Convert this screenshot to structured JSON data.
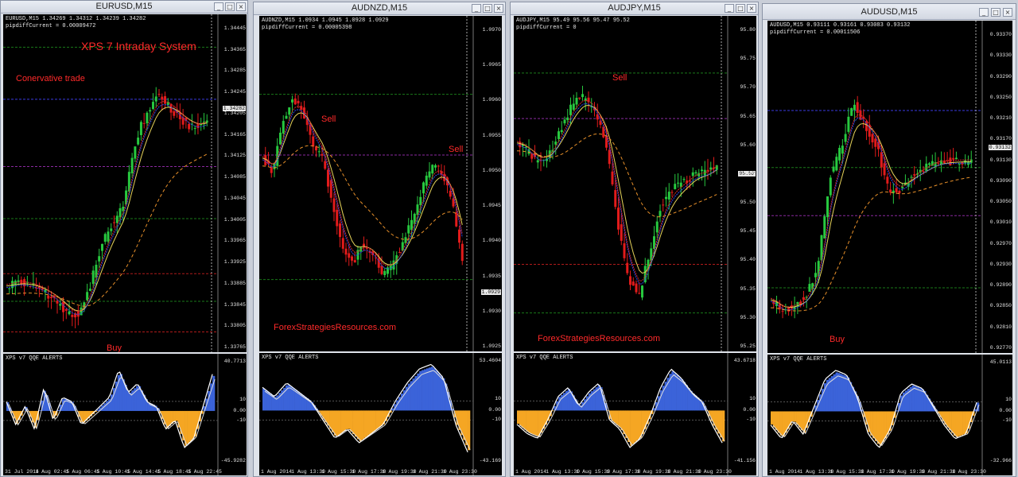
{
  "colors": {
    "bull": "#27c93f",
    "bear": "#e21b1b",
    "qqe_pos": "#3b63d9",
    "qqe_neg": "#f5a623",
    "ma_yellow": "#e6d35a",
    "ma_blue": "#2d46e6",
    "ma_red": "#d42a2a",
    "ma_orange": "#e8902a",
    "arrow_up": "#4fc3e8"
  },
  "windows": [
    {
      "title": "EURUSD,M15",
      "header": "EURUSD,M15  1.34269 1.34312 1.34239 1.34282",
      "sub": "pipdiffCurrent = 0.00009472",
      "watermark": "XPS 7 Intraday System",
      "note": "Conervative trade",
      "buy": "Buy",
      "sell": "",
      "site": "",
      "price_tag": "1.34282",
      "qqe_label": "XPS v7 QQE ALERTS",
      "yticks": [
        "1.34445",
        "1.34365",
        "1.34285",
        "1.34245",
        "1.34205",
        "1.34165",
        "1.34125",
        "1.34085",
        "1.34045",
        "1.34005",
        "1.33965",
        "1.33925",
        "1.33885",
        "1.33845",
        "1.33805",
        "1.33765"
      ],
      "qqe_ticks": [
        "40.7713",
        "10",
        "0.00",
        "-10",
        "-45.9282"
      ],
      "xticks": [
        "31 Jul 2014",
        "1 Aug 02:45",
        "1 Aug 06:45",
        "1 Aug 10:45",
        "1 Aug 14:45",
        "1 Aug 18:45",
        "1 Aug 22:45"
      ]
    },
    {
      "title": "AUDNZD,M15",
      "header": "AUDNZD,M15  1.0934 1.0945 1.0928 1.0929",
      "sub": "pipdiffCurrent = 0.00005398",
      "watermark": "",
      "note": "",
      "buy": "",
      "sell": "Sell",
      "sell2": "Sell",
      "site": "ForexStrategiesResources.com",
      "price_tag": "1.0929",
      "qqe_label": "XPS v7 QQE ALERTS",
      "yticks": [
        "1.0970",
        "1.0965",
        "1.0960",
        "1.0955",
        "1.0950",
        "1.0945",
        "1.0940",
        "1.0935",
        "1.0930",
        "1.0925"
      ],
      "qqe_ticks": [
        "53.4604",
        "10",
        "0.00",
        "-10",
        "-43.169"
      ],
      "xticks": [
        "1 Aug 2014",
        "1 Aug 13:30",
        "1 Aug 15:30",
        "1 Aug 17:30",
        "1 Aug 19:30",
        "1 Aug 21:30",
        "1 Aug 23:30"
      ]
    },
    {
      "title": "AUDJPY,M15",
      "header": "AUDJPY,M15  95.49 95.56 95.47 95.52",
      "sub": "pipdiffCurrent = 0",
      "watermark": "",
      "note": "",
      "buy": "",
      "sell": "Sell",
      "site": "ForexStrategiesResources.com",
      "price_tag": "95.52",
      "qqe_label": "XPS v7 QQE ALERTS",
      "yticks": [
        "95.80",
        "95.75",
        "95.70",
        "95.65",
        "95.60",
        "95.55",
        "95.50",
        "95.45",
        "95.40",
        "95.35",
        "95.30",
        "95.25"
      ],
      "qqe_ticks": [
        "43.6718",
        "10",
        "0.00",
        "-10",
        "-41.156"
      ],
      "xticks": [
        "1 Aug 2014",
        "1 Aug 13:30",
        "1 Aug 15:30",
        "1 Aug 17:30",
        "1 Aug 19:30",
        "1 Aug 21:30",
        "1 Aug 23:30"
      ]
    },
    {
      "title": "AUDUSD,M15",
      "header": "AUDUSD,M15  0.93111 0.93161 0.93083 0.93132",
      "sub": "pipdiffCurrent = 0.00011506",
      "watermark": "",
      "note": "",
      "buy": "Buy",
      "sell": "",
      "site": "",
      "price_tag": "0.93132",
      "qqe_label": "XPS v7 QQE ALERTS",
      "yticks": [
        "0.93370",
        "0.93330",
        "0.93290",
        "0.93250",
        "0.93210",
        "0.93170",
        "0.93130",
        "0.93090",
        "0.93050",
        "0.93010",
        "0.92970",
        "0.92930",
        "0.92890",
        "0.92850",
        "0.92810",
        "0.92770"
      ],
      "qqe_ticks": [
        "45.0113",
        "10",
        "0.00",
        "-10",
        "-32.966"
      ],
      "xticks": [
        "1 Aug 2014",
        "1 Aug 13:30",
        "1 Aug 15:30",
        "1 Aug 17:30",
        "1 Aug 19:30",
        "1 Aug 21:30",
        "1 Aug 23:30"
      ]
    }
  ]
}
